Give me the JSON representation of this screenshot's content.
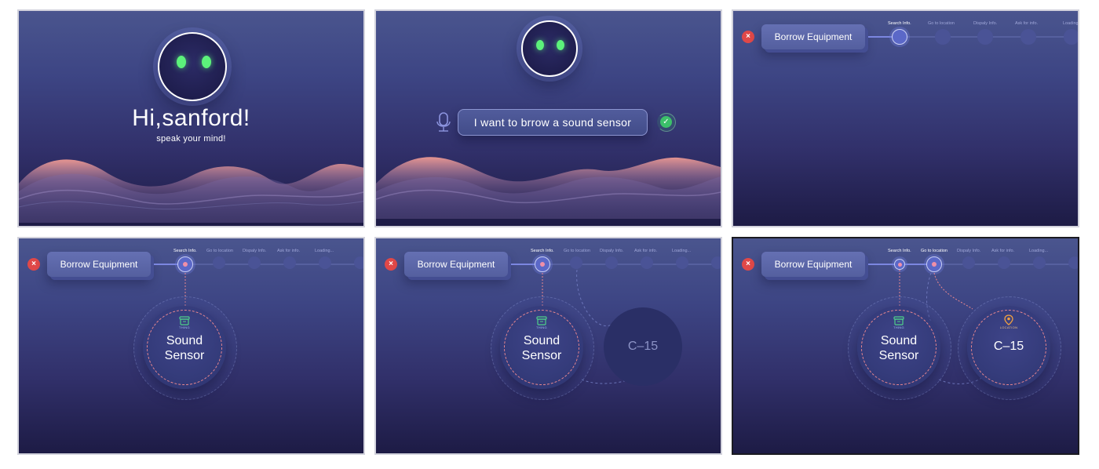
{
  "panels": [
    {
      "id": "greeting",
      "greeting": "Hi,sanford!",
      "subtitle": "speak your mind!"
    },
    {
      "id": "voice-input",
      "utterance": "I want to brrow a sound sensor"
    },
    {
      "id": "step-search",
      "title": "Borrow Equipment",
      "active_step": 0
    },
    {
      "id": "step-thing",
      "title": "Borrow Equipment",
      "active_step": 0,
      "thing": "Sound Sensor"
    },
    {
      "id": "step-location-preview",
      "title": "Borrow Equipment",
      "active_step": 0,
      "thing": "Sound Sensor",
      "location": "C–15"
    },
    {
      "id": "step-location",
      "title": "Borrow Equipment",
      "active_step": 1,
      "thing": "Sound Sensor",
      "location": "C–15"
    }
  ],
  "steps": [
    "Search Info.",
    "Go to location",
    "Dispaly Info.",
    "Ask for info.",
    "Loading..."
  ],
  "labels": {
    "thing_caption": "THING",
    "location_caption": "LOCATION",
    "close": "×"
  },
  "colors": {
    "eye": "#5cf27b",
    "close": "#e04848",
    "confirm": "#3cc06a",
    "wave": "#ee8f8f",
    "accent": "#7b86e0"
  },
  "icons": [
    "robot-face-icon",
    "microphone-icon",
    "check-icon",
    "close-icon",
    "container-icon",
    "location-pin-icon"
  ]
}
